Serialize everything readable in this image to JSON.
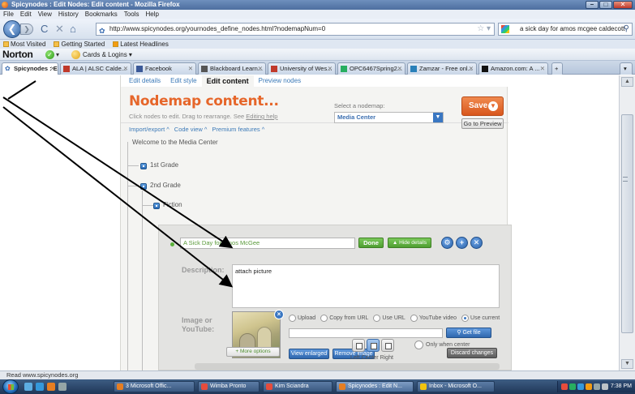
{
  "window": {
    "title": "Spicynodes : Edit Nodes: Edit content - Mozilla Firefox",
    "buttons": {
      "minimize": "–",
      "maximize": "□",
      "close": "✕"
    }
  },
  "menu": {
    "items": [
      "File",
      "Edit",
      "View",
      "History",
      "Bookmarks",
      "Tools",
      "Help"
    ]
  },
  "nav": {
    "back_glyph": "❮",
    "forward_glyph": "❯",
    "reload_glyph": "C",
    "stop_glyph": "✕",
    "home_glyph": "⌂",
    "url": "http://www.spicynodes.org/yournodes_define_nodes.html?nodemapNum=0",
    "search_text": "a sick day for amos mcgee caldecott"
  },
  "bookmarks": {
    "items": [
      "Most Visited",
      "Getting Started",
      "Latest Headlines"
    ]
  },
  "norton": {
    "logo": "Norton",
    "drop": "▾",
    "cards_label": "Cards & Logins ▾"
  },
  "tabs": [
    {
      "label": "Spicynodes : Edi...",
      "active": true
    },
    {
      "label": "ALA | ALSC Calde...",
      "active": false
    },
    {
      "label": "Facebook",
      "active": false
    },
    {
      "label": "Blackboard Learn...",
      "active": false
    },
    {
      "label": "University of Wes...",
      "active": false
    },
    {
      "label": "OPC6467Spring2...",
      "active": false
    },
    {
      "label": "Zamzar - Free onl...",
      "active": false
    },
    {
      "label": "Amazon.com: A ...",
      "active": false
    }
  ],
  "editor": {
    "tabs": [
      "Edit details",
      "Edit style",
      "Edit content",
      "Preview nodes"
    ],
    "title": "Nodemap content...",
    "subtitle": "Click nodes to edit. Drag to rearrange. See",
    "subtitle_link": "Editing help",
    "links": [
      "Import/export ^",
      "Code view ^",
      "Premium features ^"
    ],
    "select_label": "Select a nodemap:",
    "select_value": "Media Center",
    "save_label": "Save",
    "preview_label": "Go to Preview"
  },
  "tree": {
    "root": "Welcome to the Media Center",
    "nodes": [
      "1st Grade",
      "2nd Grade",
      "Fiction"
    ]
  },
  "node_edit": {
    "title_value": "A Sick Day for Amos McGee",
    "done_label": "Done",
    "hide_details_label": "▲ Hide details",
    "description_label": "Description:",
    "description_value": "attach picture",
    "image_label": "Image or YouTube:",
    "image_options": [
      "Upload",
      "Copy from URL",
      "Use URL",
      "YouTube video",
      "Use current"
    ],
    "selected_option": "Use current",
    "get_file_label": "Get file",
    "view_enlarged_label": "View enlarged",
    "remove_image_label": "Remove image",
    "align_labels": "Left  Center Right",
    "center_only_label": "Only when center",
    "more_options_label": "+ More options",
    "discard_label": "Discard changes"
  },
  "status": {
    "text": "Read www.spicynodes.org"
  },
  "taskbar": {
    "tasks": [
      "3 Microsoft Offic...",
      "Wimba Pronto",
      "Kim Sciandra",
      "Spicynodes : Edit N...",
      "Inbox - Microsoft O..."
    ],
    "clock": "7:38 PM"
  },
  "colors": {
    "accent_orange": "#e6662a",
    "link_blue": "#3c7ab8",
    "done_green": "#4f9e31"
  }
}
